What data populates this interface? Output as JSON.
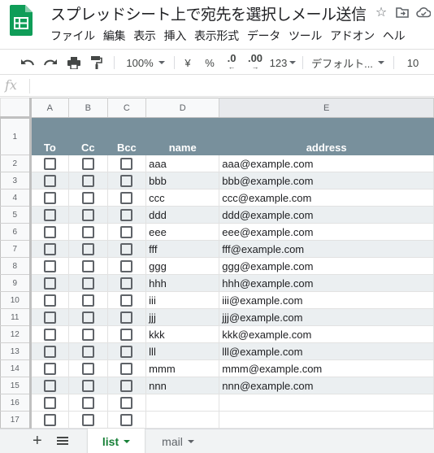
{
  "doc": {
    "title": "スプレッドシート上で宛先を選択しメール送信"
  },
  "menu": [
    "ファイル",
    "編集",
    "表示",
    "挿入",
    "表示形式",
    "データ",
    "ツール",
    "アドオン",
    "ヘル"
  ],
  "toolbar": {
    "zoom": "100%",
    "currency": "¥",
    "percent": "%",
    "decrease_decimal": ".0",
    "increase_decimal": ".00",
    "number_format": "123",
    "font": "デフォルト...",
    "font_size": "10"
  },
  "formula_bar": {
    "fx_label": "fx",
    "value": ""
  },
  "columns": [
    "A",
    "B",
    "C",
    "D",
    "E"
  ],
  "header": {
    "row_number": "1",
    "labels": [
      "To",
      "Cc",
      "Bcc",
      "name",
      "address"
    ]
  },
  "rows": [
    {
      "num": "2",
      "name": "aaa",
      "address": "aaa@example.com"
    },
    {
      "num": "3",
      "name": "bbb",
      "address": "bbb@example.com"
    },
    {
      "num": "4",
      "name": "ccc",
      "address": "ccc@example.com"
    },
    {
      "num": "5",
      "name": "ddd",
      "address": "ddd@example.com"
    },
    {
      "num": "6",
      "name": "eee",
      "address": "eee@example.com"
    },
    {
      "num": "7",
      "name": "fff",
      "address": "fff@example.com"
    },
    {
      "num": "8",
      "name": "ggg",
      "address": "ggg@example.com"
    },
    {
      "num": "9",
      "name": "hhh",
      "address": "hhh@example.com"
    },
    {
      "num": "10",
      "name": "iii",
      "address": "iii@example.com"
    },
    {
      "num": "11",
      "name": "jjj",
      "address": "jjj@example.com"
    },
    {
      "num": "12",
      "name": "kkk",
      "address": "kkk@example.com"
    },
    {
      "num": "13",
      "name": "lll",
      "address": "lll@example.com"
    },
    {
      "num": "14",
      "name": "mmm",
      "address": "mmm@example.com"
    },
    {
      "num": "15",
      "name": "nnn",
      "address": "nnn@example.com"
    },
    {
      "num": "16",
      "name": "",
      "address": ""
    },
    {
      "num": "17",
      "name": "",
      "address": ""
    }
  ],
  "sheet_tabs": {
    "active": "list",
    "other": "mail"
  },
  "colors": {
    "header_fill": "#78909c",
    "band_fill": "#ebeff1",
    "active_tab": "#188038",
    "logo_green": "#0f9d58"
  }
}
